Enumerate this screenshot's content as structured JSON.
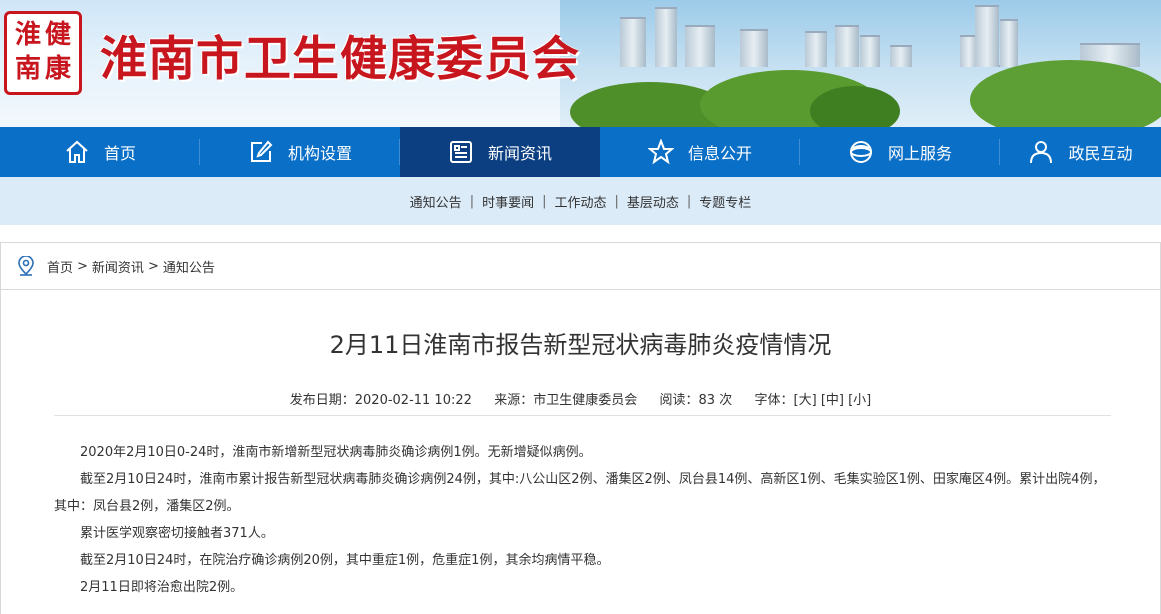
{
  "header": {
    "seal_chars": [
      "淮",
      "健",
      "南",
      "康"
    ],
    "site_title": "淮南市卫生健康委员会"
  },
  "main_nav": [
    {
      "label": "首页",
      "icon": "home-icon"
    },
    {
      "label": "机构设置",
      "icon": "edit-icon"
    },
    {
      "label": "新闻资讯",
      "icon": "news-icon",
      "active": true
    },
    {
      "label": "信息公开",
      "icon": "star-icon"
    },
    {
      "label": "网上服务",
      "icon": "globe-icon"
    },
    {
      "label": "政民互动",
      "icon": "user-icon"
    }
  ],
  "sub_nav": [
    "通知公告",
    "时事要闻",
    "工作动态",
    "基层动态",
    "专题专栏"
  ],
  "breadcrumb": [
    "首页",
    "新闻资讯",
    "通知公告"
  ],
  "article": {
    "title": "2月11日淮南市报告新型冠状病毒肺炎疫情情况",
    "meta": {
      "date_label": "发布日期：",
      "date": "2020-02-11 10:22",
      "source_label": "来源：",
      "source": "市卫生健康委员会",
      "views_label": "阅读：",
      "views": "83",
      "views_unit": "次",
      "font_label": "字体：",
      "font_large": "[大]",
      "font_medium": "[中]",
      "font_small": "[小]"
    },
    "paragraphs": [
      "2020年2月10日0-24时，淮南市新增新型冠状病毒肺炎确诊病例1例。无新增疑似病例。",
      "截至2月10日24时，淮南市累计报告新型冠状病毒肺炎确诊病例24例，其中:八公山区2例、潘集区2例、凤台县14例、高新区1例、毛集实验区1例、田家庵区4例。累计出院4例，其中：凤台县2例，潘集区2例。",
      "累计医学观察密切接触者371人。",
      "截至2月10日24时，在院治疗确诊病例20例，其中重症1例，危重症1例，其余均病情平稳。",
      "2月11日即将治愈出院2例。"
    ]
  },
  "colors": {
    "brand_red": "#c8161e",
    "nav_blue": "#0a6fc6",
    "nav_active": "#0b3f82",
    "subnav_bg": "#dbebf8"
  }
}
